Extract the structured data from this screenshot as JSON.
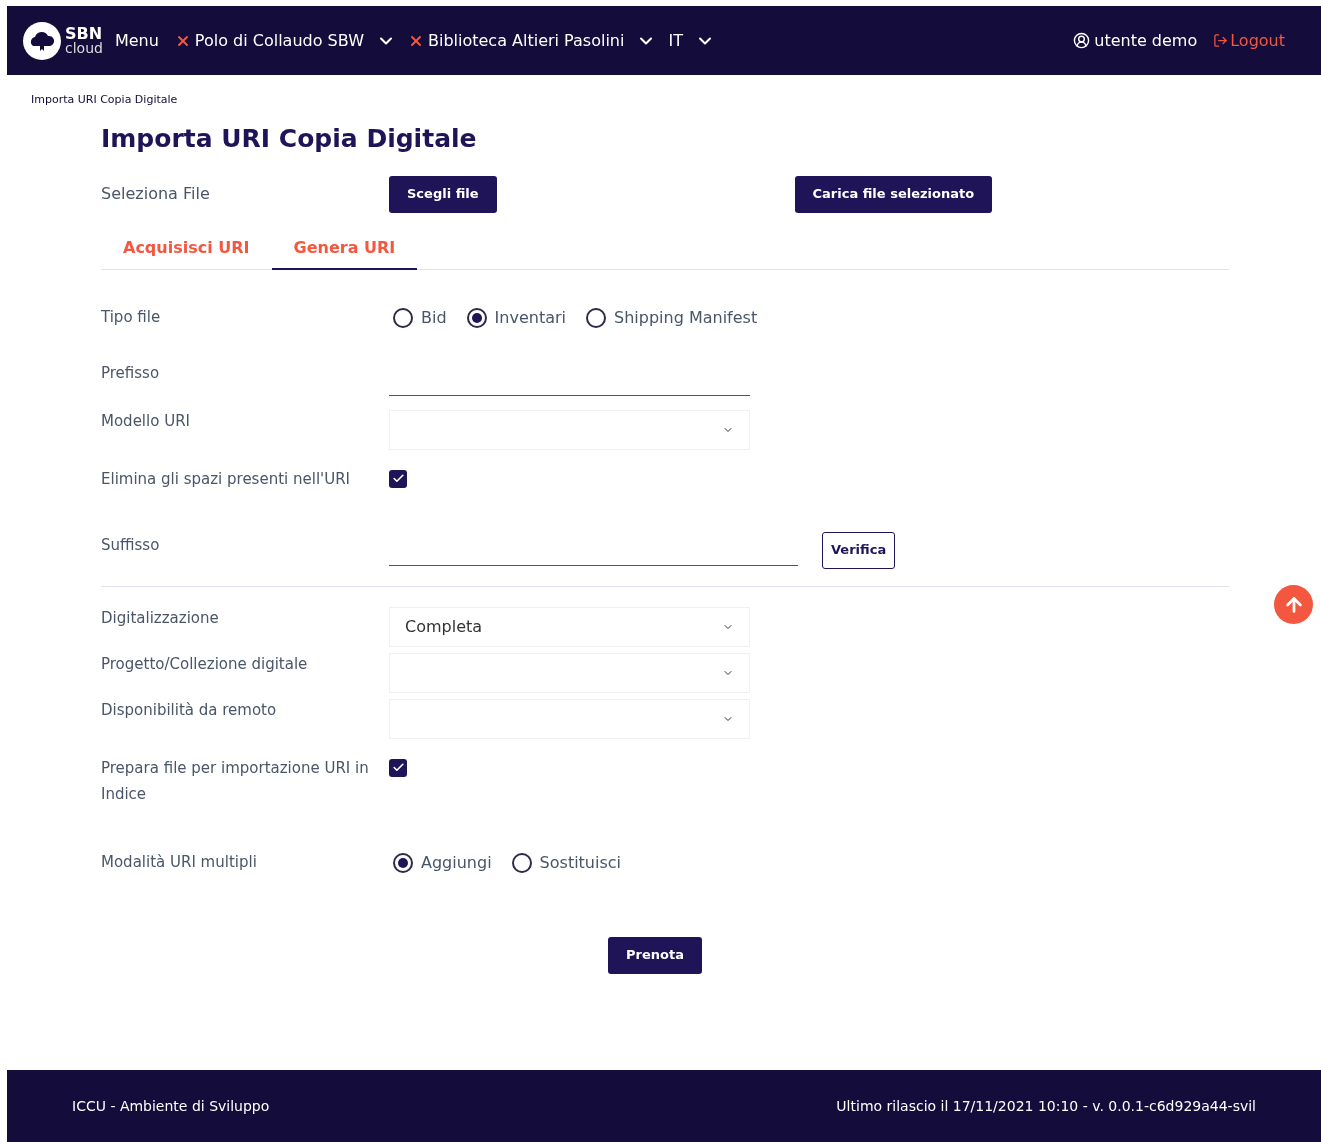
{
  "header": {
    "logo": {
      "top": "SBN",
      "bottom": "cloud"
    },
    "menu": "Menu",
    "selectors": [
      {
        "label": "Polo di Collaudo SBW",
        "removable": true
      },
      {
        "label": "Biblioteca Altieri Pasolini",
        "removable": true
      },
      {
        "label": "IT",
        "removable": false
      }
    ],
    "user": "utente demo",
    "logout": "Logout"
  },
  "breadcrumb": "Importa URI Copia Digitale",
  "title": "Importa URI Copia Digitale",
  "file_row": {
    "label": "Seleziona File",
    "choose_button": "Scegli file",
    "upload_button": "Carica file selezionato"
  },
  "tabs": [
    {
      "label": "Acquisisci URI",
      "selected": false
    },
    {
      "label": "Genera URI",
      "selected": true
    }
  ],
  "uri_fields": [
    {
      "kind": "radio",
      "label": "Tipo file",
      "options": [
        {
          "label": "Bid",
          "selected": false
        },
        {
          "label": "Inventari",
          "selected": true
        },
        {
          "label": "Shipping Manifest",
          "selected": false
        }
      ]
    },
    {
      "kind": "text",
      "label": "Prefisso"
    },
    {
      "kind": "select",
      "label": "Modello URI"
    },
    {
      "kind": "checkbox",
      "label": "Elimina gli spazi presenti nell'URI",
      "checked": true
    },
    {
      "kind": "text_button",
      "label": "Suffisso",
      "button": "Verifica"
    }
  ],
  "digital_fields": [
    {
      "kind": "select",
      "label": "Digitalizzazione",
      "value": "Completa"
    },
    {
      "kind": "select",
      "label": "Progetto/Collezione digitale"
    },
    {
      "kind": "select",
      "label": "Disponibilità da remoto"
    },
    {
      "kind": "checkbox",
      "label": "Prepara file per importazione URI in Indice",
      "checked": true
    },
    {
      "kind": "radio",
      "label": "Modalità URI multipli",
      "options": [
        {
          "label": "Aggiungi",
          "selected": true
        },
        {
          "label": "Sostituisci",
          "selected": false
        }
      ]
    }
  ],
  "submit": "Prenota",
  "footer": {
    "left": "ICCU - Ambiente di Sviluppo",
    "right": "Ultimo rilascio il 17/11/2021 10:10 - v. 0.0.1-c6d929a44-svil"
  }
}
